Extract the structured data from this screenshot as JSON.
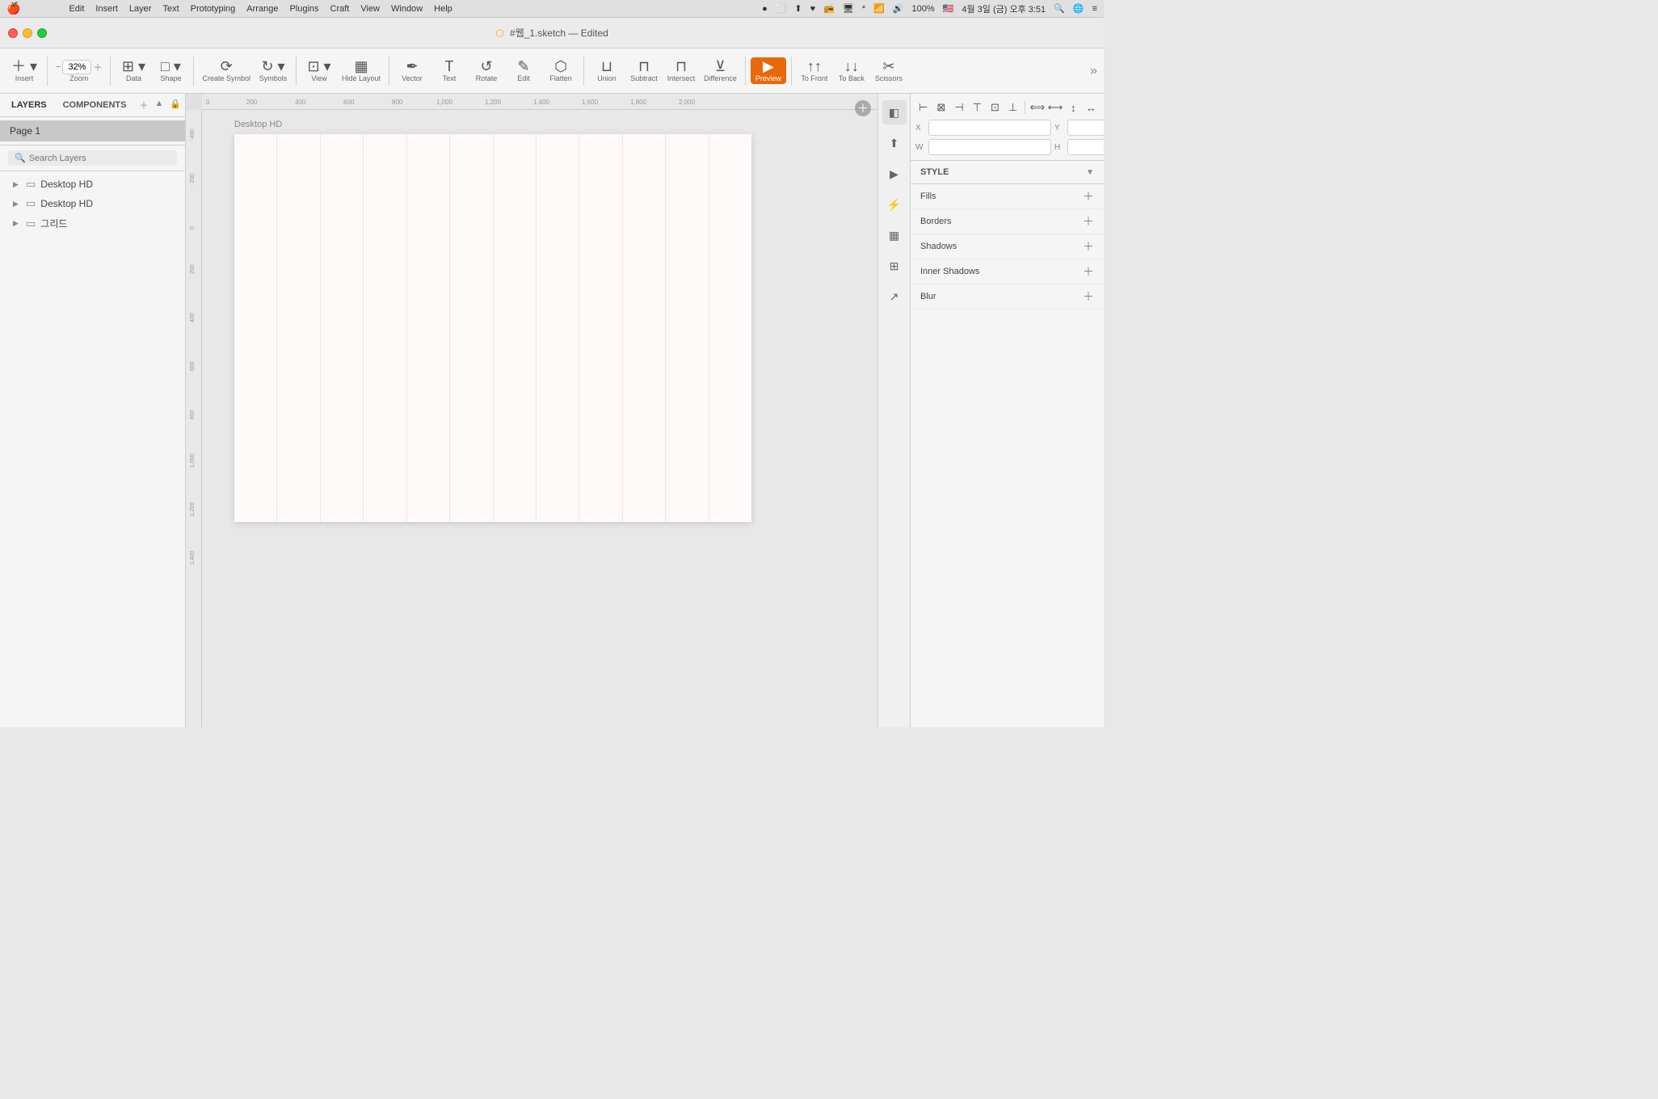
{
  "menubar": {
    "items": [
      "Edit",
      "Insert",
      "Layer",
      "Text",
      "Prototyping",
      "Arrange",
      "Plugins",
      "Craft",
      "View",
      "Window",
      "Help"
    ],
    "time": "4월 3일 (금) 오후 3:51",
    "battery": "100%"
  },
  "titlebar": {
    "filename": "#웹_1.sketch",
    "status": "Edited"
  },
  "toolbar": {
    "insert_label": "Insert",
    "zoom_label": "Zoom",
    "zoom_value": "32%",
    "data_label": "Data",
    "shape_label": "Shape",
    "create_symbol_label": "Create Symbol",
    "symbols_label": "Symbols",
    "view_label": "View",
    "hide_layout_label": "Hide Layout",
    "vector_label": "Vector",
    "text_label": "Text",
    "rotate_label": "Rotate",
    "edit_label": "Edit",
    "flatten_label": "Flatten",
    "union_label": "Union",
    "subtract_label": "Subtract",
    "intersect_label": "Intersect",
    "difference_label": "Difference",
    "preview_label": "Preview",
    "to_front_label": "To Front",
    "to_back_label": "To Back",
    "scissors_label": "Scissors"
  },
  "doc_title": "#웹_1.sketch — Edited",
  "left_panel": {
    "tab_layers": "LAYERS",
    "tab_components": "COMPONENTS",
    "page_name": "Page 1",
    "search_placeholder": "Search Layers",
    "layers": [
      {
        "name": "Desktop HD",
        "type": "artboard"
      },
      {
        "name": "Desktop HD",
        "type": "artboard"
      },
      {
        "name": "그리드",
        "type": "artboard"
      }
    ]
  },
  "canvas": {
    "artboard_label": "Desktop HD",
    "ruler_marks_h": [
      0,
      200,
      400,
      600,
      800,
      1000,
      1200,
      1400,
      1600,
      1800,
      2000
    ],
    "ruler_marks_v": [
      -400,
      -200,
      0,
      200,
      400,
      600,
      800,
      1000,
      1200,
      1400
    ]
  },
  "right_panel": {
    "icons": [
      {
        "name": "inspector-icon",
        "symbol": "◧"
      },
      {
        "name": "export-icon",
        "symbol": "↑"
      },
      {
        "name": "play-icon",
        "symbol": "▶"
      },
      {
        "name": "lightning-icon",
        "symbol": "⚡"
      },
      {
        "name": "layers-icon",
        "symbol": "▦"
      },
      {
        "name": "image-icon",
        "symbol": "⊞"
      },
      {
        "name": "export2-icon",
        "symbol": "↗"
      }
    ],
    "align_buttons": [
      "⊞",
      "≡",
      "⊟",
      "↔",
      "↕",
      "⇔",
      "⊠",
      "⊡",
      "⊢",
      "⊣"
    ],
    "x_label": "X",
    "y_label": "Y",
    "w_label": "W",
    "h_label": "H",
    "x_value": "",
    "y_value": "",
    "w_value": "",
    "h_value": "",
    "style_label": "STYLE",
    "fills_label": "Fills",
    "borders_label": "Borders",
    "shadows_label": "Shadows",
    "inner_shadows_label": "Inner Shadows",
    "blur_label": "Blur"
  }
}
